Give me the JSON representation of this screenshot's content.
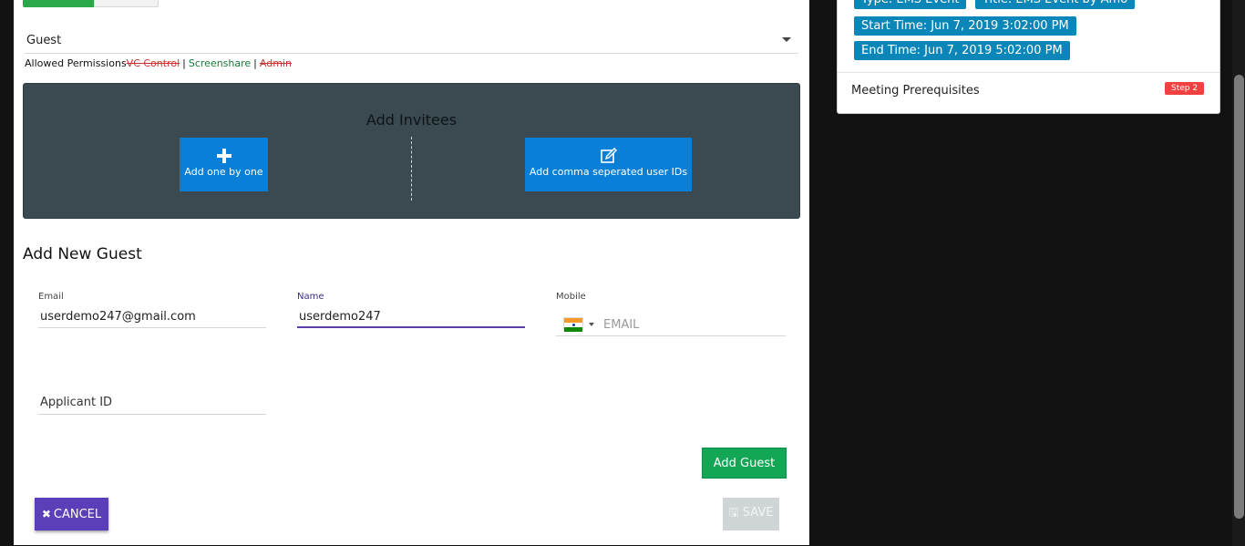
{
  "role_select": {
    "value": "Guest"
  },
  "permissions": {
    "label": "Allowed Permissions",
    "items": [
      {
        "label": "VC Control",
        "enabled": false
      },
      {
        "label": "Screenshare",
        "enabled": true
      },
      {
        "label": "Admin",
        "enabled": false
      }
    ],
    "separator": "|"
  },
  "invitees": {
    "title": "Add Invitees",
    "add_one_label": "Add one by one",
    "add_comma_label": "Add comma seperated user IDs"
  },
  "guest_form": {
    "title": "Add New Guest",
    "email": {
      "label": "Email",
      "value": "userdemo247@gmail.com"
    },
    "name": {
      "label": "Name",
      "value": "userdemo247"
    },
    "mobile": {
      "label": "Mobile",
      "placeholder": "EMAIL",
      "country": "India"
    },
    "applicant_id": {
      "placeholder": "Applicant ID",
      "value": ""
    },
    "add_button": "Add Guest"
  },
  "footer": {
    "cancel_label": "CANCEL",
    "save_label": "SAVE",
    "save_enabled": false
  },
  "event_info": {
    "type": "Type: EMS Event",
    "title": "Title: EMS Event by Amo",
    "start": "Start Time: Jun 7, 2019 3:02:00 PM",
    "end": "End Time: Jun 7, 2019 5:02:00 PM",
    "prerequisites_label": "Meeting Prerequisites",
    "step_badge": "Step 2"
  },
  "colors": {
    "accent_purple": "#5a3fb8",
    "add_green": "#13a654",
    "badge_blue": "#0b86b8",
    "invite_blue": "#0a7fd8",
    "step_red": "#f04040"
  }
}
